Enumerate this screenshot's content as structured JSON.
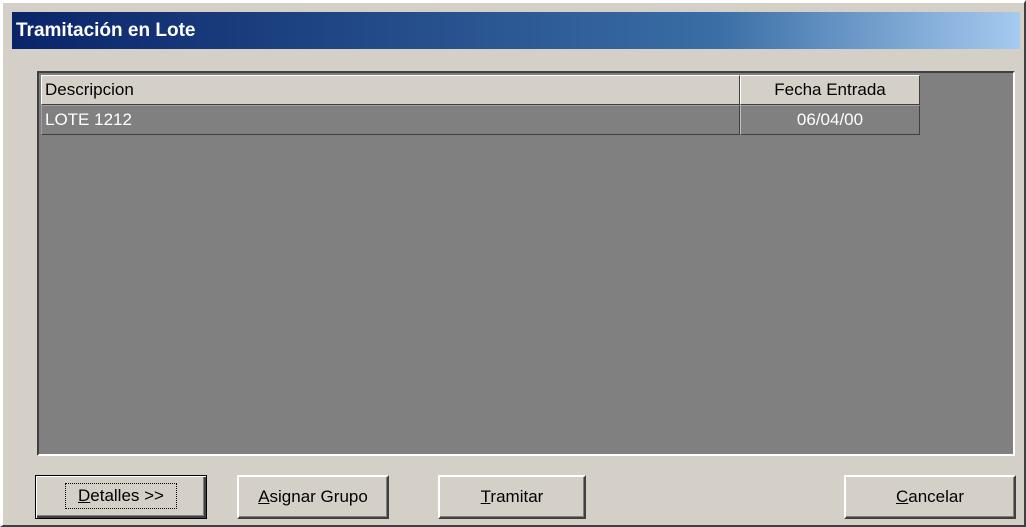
{
  "window": {
    "title": "Tramitación en Lote"
  },
  "grid": {
    "columns": [
      "Descripcion",
      "Fecha Entrada"
    ],
    "rows": [
      {
        "descripcion": "LOTE 1212",
        "fecha": "06/04/00"
      }
    ]
  },
  "buttons": {
    "detalles": {
      "mnemonic": "D",
      "rest": "etalles >>"
    },
    "asignar": {
      "mnemonic": "A",
      "rest": "signar Grupo"
    },
    "tramitar": {
      "mnemonic": "T",
      "rest": "ramitar"
    },
    "cancelar": {
      "mnemonic": "C",
      "rest": "ancelar"
    }
  },
  "colors": {
    "title_gradient_start": "#0a246a",
    "title_gradient_end": "#a6caf0",
    "face": "#d4d0c8",
    "grid_background": "#808080"
  }
}
